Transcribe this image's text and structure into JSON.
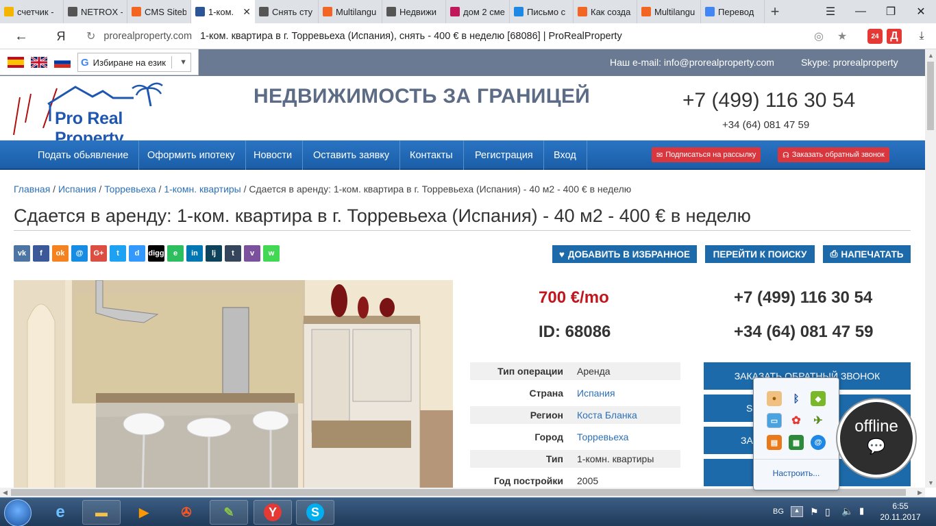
{
  "browser": {
    "tabs": [
      {
        "label": "счетчик -",
        "favicon": "bar-chart-icon",
        "color": "#f4b400"
      },
      {
        "label": "NETROX -",
        "favicon": "house-icon",
        "color": "#555555"
      },
      {
        "label": "CMS Siteb",
        "favicon": "s-icon",
        "color": "#f26522"
      },
      {
        "label": "1-ком.",
        "favicon": "frp-icon",
        "color": "#2b5597"
      },
      {
        "label": "Снять сту",
        "favicon": "house-icon",
        "color": "#555555"
      },
      {
        "label": "Multilangu",
        "favicon": "s-icon",
        "color": "#f26522"
      },
      {
        "label": "Недвижи",
        "favicon": "house-icon",
        "color": "#555555"
      },
      {
        "label": "дом 2 сме",
        "favicon": "two-icon",
        "color": "#c2185b"
      },
      {
        "label": "Письмо с",
        "favicon": "mail-icon",
        "color": "#1e88e5"
      },
      {
        "label": "Как созда",
        "favicon": "s-icon",
        "color": "#f26522"
      },
      {
        "label": "Multilangu",
        "favicon": "s-icon",
        "color": "#f26522"
      },
      {
        "label": "Перевод",
        "favicon": "translate-icon",
        "color": "#4285f4"
      }
    ],
    "new_tab": "+",
    "yandex_letter": "Я",
    "url_domain": "prorealproperty.com",
    "url_title": "1-ком. квартира в г. Торревьеха (Испания), снять - 400 € в неделю [68086] | ProRealProperty",
    "badge": "24"
  },
  "top": {
    "email": "Наш e-mail: info@prorealproperty.com",
    "skype": "Skype: prorealproperty",
    "translate_label": "Избиране на език"
  },
  "header": {
    "logo_text": "Pro Real Property",
    "title": "НЕДВИЖИМОСТЬ ЗА ГРАНИЦЕЙ",
    "phone_main": "+7 (499) 116 30 54",
    "phone_alt": "+34 (64) 081 47 59"
  },
  "nav": {
    "items": [
      "Подать обьявление",
      "Оформить ипотеку",
      "Новости",
      "Оставить заявку",
      "Контакты",
      "Регистрация",
      "Вход"
    ],
    "subscribe": "Подписаться на рассылку",
    "callback": "Заказать обратный звонок"
  },
  "breadcrumbs": {
    "links": [
      "Главная",
      "Испания",
      "Торревьеха",
      "1-комн. квартиры"
    ],
    "current": "Сдается в аренду: 1-ком. квартира в г. Торревьеха (Испания) - 40 м2 - 400 € в неделю",
    "separator": " / "
  },
  "listing": {
    "title": "Сдается в аренду: 1-ком. квартира в г. Торревьеха (Испания) - 40 м2 - 400 € в неделю",
    "price": "700 €/mo",
    "id": "ID: 68086",
    "phone1": "+7 (499) 116 30 54",
    "phone2": "+34 (64) 081 47 59",
    "props": [
      {
        "key": "Тип операции",
        "value": "Аренда"
      },
      {
        "key": "Страна",
        "value": "Испания"
      },
      {
        "key": "Регион",
        "value": "Коста Бланка"
      },
      {
        "key": "Город",
        "value": "Торревьеха"
      },
      {
        "key": "Тип",
        "value": "1-комн. квартиры"
      },
      {
        "key": "Год постройки",
        "value": "2005"
      }
    ],
    "actions": {
      "favorite": "ДОБАВИТЬ В ИЗБРАННОЕ",
      "search": "ПЕРЕЙТИ К ПОИСКУ",
      "print": "НАПЕЧАТАТЬ"
    },
    "side_buttons": [
      "ЗАКАЗАТЬ ОБРАТНЫЙ ЗВОНОК",
      "S",
      "ЗА",
      ""
    ]
  },
  "share": [
    {
      "name": "vk",
      "label": "vk",
      "color": "#4c75a3"
    },
    {
      "name": "facebook",
      "label": "f",
      "color": "#3b5998"
    },
    {
      "name": "odnoklassniki",
      "label": "ok",
      "color": "#f58220"
    },
    {
      "name": "moimir",
      "label": "@",
      "color": "#168de2"
    },
    {
      "name": "googleplus",
      "label": "G+",
      "color": "#dc4e41"
    },
    {
      "name": "twitter",
      "label": "t",
      "color": "#1da1f2"
    },
    {
      "name": "delicious",
      "label": "d",
      "color": "#3399ff"
    },
    {
      "name": "digg",
      "label": "digg",
      "color": "#000000"
    },
    {
      "name": "evernote",
      "label": "e",
      "color": "#2dbe60"
    },
    {
      "name": "linkedin",
      "label": "in",
      "color": "#0077b5"
    },
    {
      "name": "livejournal",
      "label": "lj",
      "color": "#0d425a"
    },
    {
      "name": "tumblr",
      "label": "t",
      "color": "#35465c"
    },
    {
      "name": "viber",
      "label": "v",
      "color": "#7b519d"
    },
    {
      "name": "whatsapp",
      "label": "w",
      "color": "#43d854"
    }
  ],
  "tray_popup": {
    "customize": "Настроить..."
  },
  "chat": {
    "status": "offline"
  },
  "taskbar": {
    "language": "BG",
    "time": "6:55",
    "date": "20.11.2017"
  },
  "colors": {
    "nav_blue": "#1d6aaa",
    "price_red": "#c0161c",
    "link_blue": "#2b70b8"
  }
}
